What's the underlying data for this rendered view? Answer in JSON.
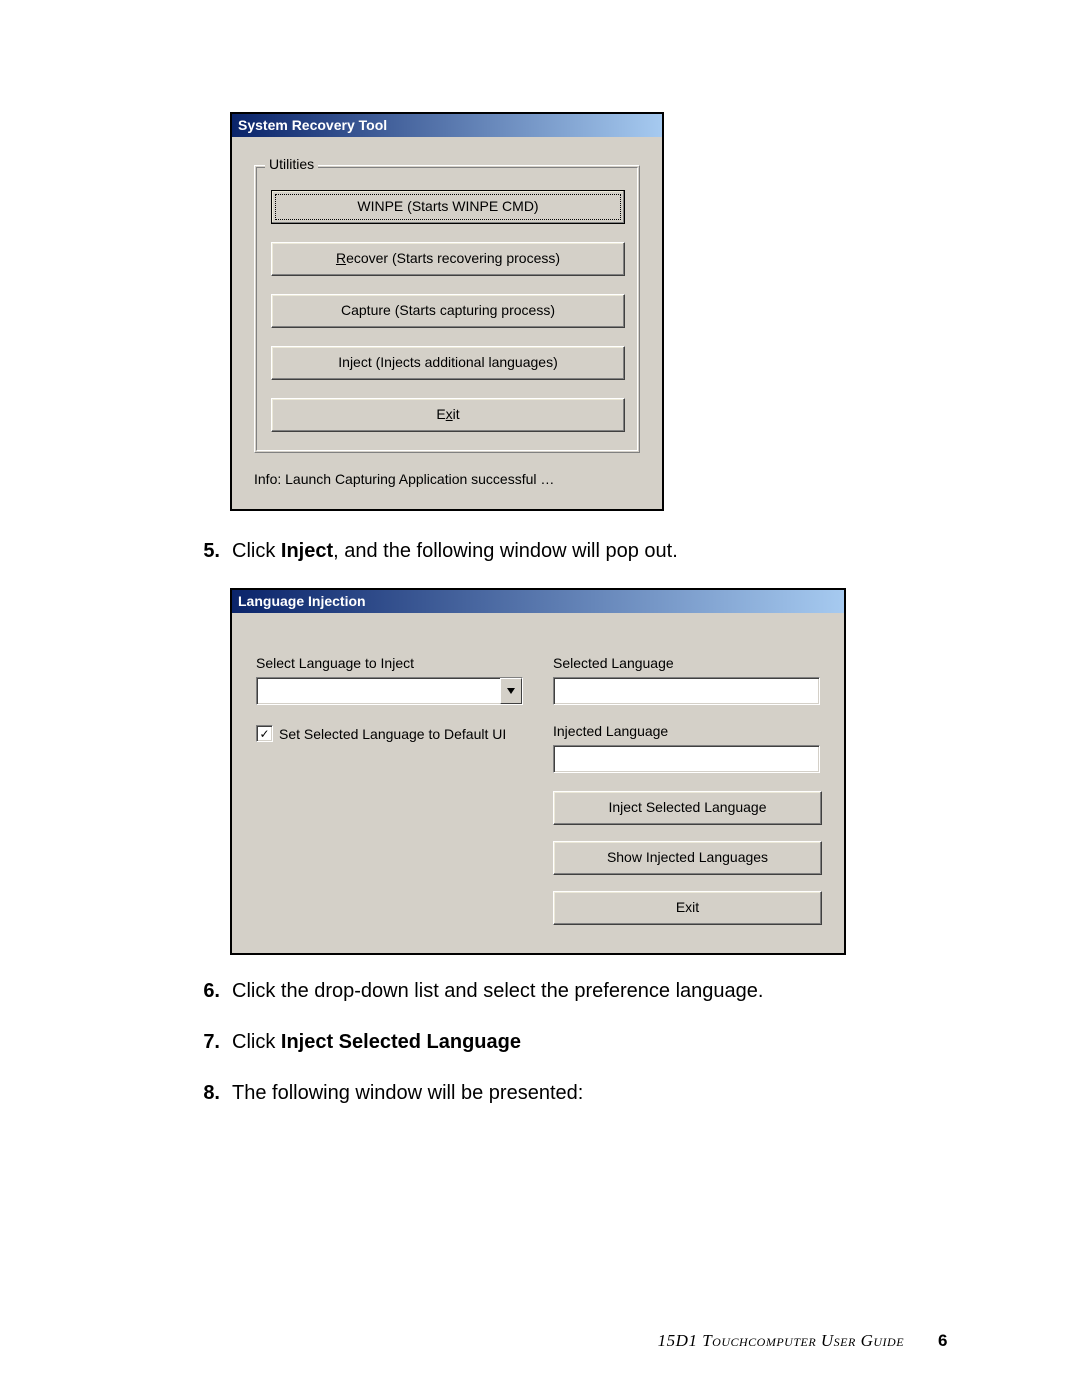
{
  "recovery_window": {
    "title": "System Recovery Tool",
    "group_label": "Utilities",
    "buttons": {
      "winpe": "WINPE (Starts WINPE CMD)",
      "recover": "Recover (Starts recovering process)",
      "capture": "Capture (Starts capturing process)",
      "inject": "Inject (Injects additional languages)",
      "exit": "Exit"
    },
    "info": "Info: Launch Capturing Application successful …"
  },
  "steps": {
    "s5_prefix": "Click ",
    "s5_bold": "Inject",
    "s5_suffix": ", and the following window will pop out.",
    "s6": "Click the drop-down list and select the preference language.",
    "s7_prefix": "Click ",
    "s7_bold": "Inject Selected Language",
    "s8": "The following window will be presented:"
  },
  "lang_window": {
    "title": "Language Injection",
    "left": {
      "select_label": "Select Language to Inject",
      "checkbox_label": "Set Selected Language to Default UI",
      "checkbox_checked": "✓"
    },
    "right": {
      "selected_label": "Selected Language",
      "injected_label": "Injected Language",
      "btn_inject": "Inject Selected Language",
      "btn_show": "Show Injected Languages",
      "btn_exit": "Exit"
    }
  },
  "footer": {
    "text": "15D1 Touchcomputer User Guide",
    "page": "6"
  }
}
